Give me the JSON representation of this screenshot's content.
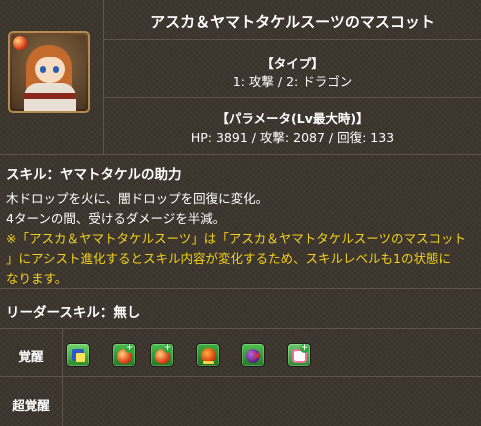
{
  "monster": {
    "name": "アスカ＆ヤマトタケルスーツのマスコット",
    "type_heading": "【タイプ】",
    "types": "1: 攻撃 / 2: ドラゴン",
    "param_heading": "【パラメータ(Lv最大時)】",
    "params": "HP: 3891 / 攻撃: 2087 / 回復: 133"
  },
  "skill": {
    "title": "スキル：ヤマトタケルの助力",
    "lines": [
      "木ドロップを火に、闇ドロップを回復に変化。",
      "4ターンの間、受けるダメージを半減。"
    ],
    "note_lines": [
      "※「アスカ＆ヤマトタケルスーツ」は「アスカ＆ヤマトタケルスーツのマスコット",
      "」にアシスト進化するとスキル内容が変化するため、スキルレベルも1の状態に",
      "なります。"
    ],
    "note_color": "#f2d21a"
  },
  "leader": {
    "label": "リーダースキル：無し"
  },
  "awakenings": {
    "label": "覚醒",
    "icons": [
      "skill-boost-awakening-icon",
      "enhanced-fire-orb-icon",
      "enhanced-fire-orb-icon",
      "enhanced-fire-row-icon",
      "poison-resist-icon",
      "enhanced-heal-orb-icon"
    ]
  },
  "super_awakenings": {
    "label": "超覚醒"
  }
}
